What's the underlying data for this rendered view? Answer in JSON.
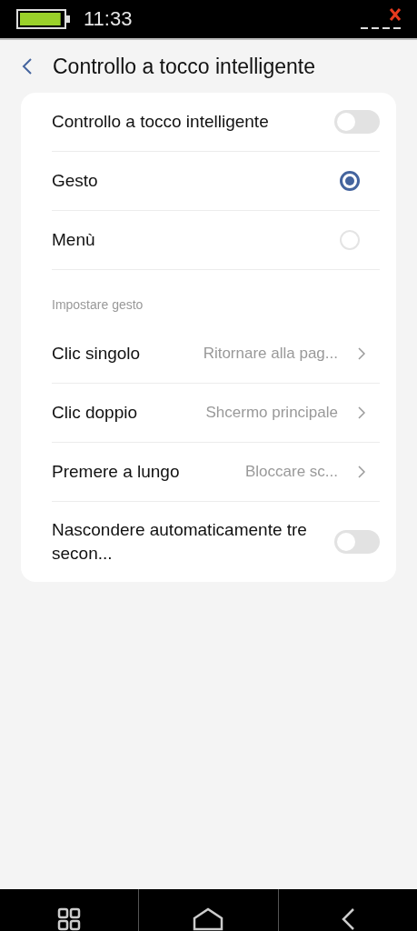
{
  "status_bar": {
    "battery": {
      "level": 0.95
    },
    "time": "11:33"
  },
  "header": {
    "title": "Controllo a tocco intelligente"
  },
  "items": [
    {
      "kind": "toggle",
      "label": "Controllo a tocco intelligente",
      "on": false
    },
    {
      "kind": "radio",
      "label": "Gesto",
      "selected": true
    },
    {
      "kind": "radio",
      "label": "Menù",
      "selected": false
    },
    {
      "kind": "section",
      "label": "Impostare gesto"
    },
    {
      "kind": "nav",
      "label": "Clic singolo",
      "value": "Ritornare alla pag..."
    },
    {
      "kind": "nav",
      "label": "Clic doppio",
      "value": "Shcermo principale"
    },
    {
      "kind": "nav",
      "label": "Premere a lungo",
      "value": "Bloccare sc..."
    },
    {
      "kind": "toggle",
      "label": "Nascondere automaticamente tre secon...",
      "on": false
    }
  ]
}
